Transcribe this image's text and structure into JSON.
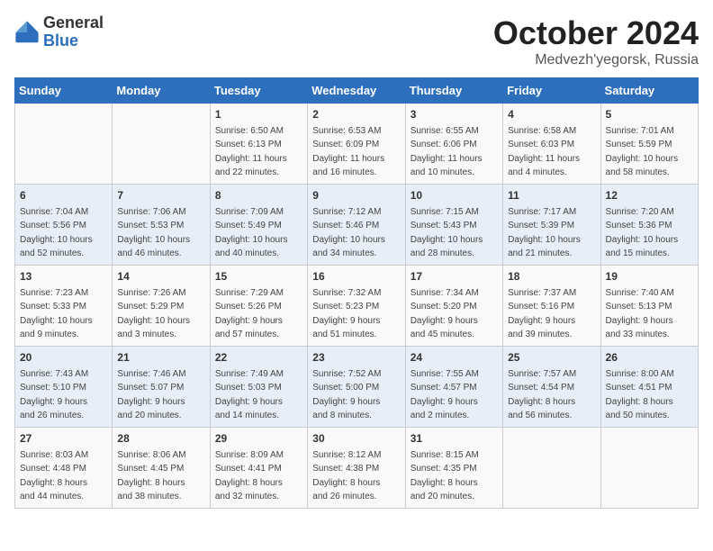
{
  "logo": {
    "general": "General",
    "blue": "Blue"
  },
  "title": {
    "month": "October 2024",
    "location": "Medvezh'yegorsk, Russia"
  },
  "days_of_week": [
    "Sunday",
    "Monday",
    "Tuesday",
    "Wednesday",
    "Thursday",
    "Friday",
    "Saturday"
  ],
  "weeks": [
    [
      {
        "day": "",
        "info": ""
      },
      {
        "day": "",
        "info": ""
      },
      {
        "day": "1",
        "info": "Sunrise: 6:50 AM\nSunset: 6:13 PM\nDaylight: 11 hours\nand 22 minutes."
      },
      {
        "day": "2",
        "info": "Sunrise: 6:53 AM\nSunset: 6:09 PM\nDaylight: 11 hours\nand 16 minutes."
      },
      {
        "day": "3",
        "info": "Sunrise: 6:55 AM\nSunset: 6:06 PM\nDaylight: 11 hours\nand 10 minutes."
      },
      {
        "day": "4",
        "info": "Sunrise: 6:58 AM\nSunset: 6:03 PM\nDaylight: 11 hours\nand 4 minutes."
      },
      {
        "day": "5",
        "info": "Sunrise: 7:01 AM\nSunset: 5:59 PM\nDaylight: 10 hours\nand 58 minutes."
      }
    ],
    [
      {
        "day": "6",
        "info": "Sunrise: 7:04 AM\nSunset: 5:56 PM\nDaylight: 10 hours\nand 52 minutes."
      },
      {
        "day": "7",
        "info": "Sunrise: 7:06 AM\nSunset: 5:53 PM\nDaylight: 10 hours\nand 46 minutes."
      },
      {
        "day": "8",
        "info": "Sunrise: 7:09 AM\nSunset: 5:49 PM\nDaylight: 10 hours\nand 40 minutes."
      },
      {
        "day": "9",
        "info": "Sunrise: 7:12 AM\nSunset: 5:46 PM\nDaylight: 10 hours\nand 34 minutes."
      },
      {
        "day": "10",
        "info": "Sunrise: 7:15 AM\nSunset: 5:43 PM\nDaylight: 10 hours\nand 28 minutes."
      },
      {
        "day": "11",
        "info": "Sunrise: 7:17 AM\nSunset: 5:39 PM\nDaylight: 10 hours\nand 21 minutes."
      },
      {
        "day": "12",
        "info": "Sunrise: 7:20 AM\nSunset: 5:36 PM\nDaylight: 10 hours\nand 15 minutes."
      }
    ],
    [
      {
        "day": "13",
        "info": "Sunrise: 7:23 AM\nSunset: 5:33 PM\nDaylight: 10 hours\nand 9 minutes."
      },
      {
        "day": "14",
        "info": "Sunrise: 7:26 AM\nSunset: 5:29 PM\nDaylight: 10 hours\nand 3 minutes."
      },
      {
        "day": "15",
        "info": "Sunrise: 7:29 AM\nSunset: 5:26 PM\nDaylight: 9 hours\nand 57 minutes."
      },
      {
        "day": "16",
        "info": "Sunrise: 7:32 AM\nSunset: 5:23 PM\nDaylight: 9 hours\nand 51 minutes."
      },
      {
        "day": "17",
        "info": "Sunrise: 7:34 AM\nSunset: 5:20 PM\nDaylight: 9 hours\nand 45 minutes."
      },
      {
        "day": "18",
        "info": "Sunrise: 7:37 AM\nSunset: 5:16 PM\nDaylight: 9 hours\nand 39 minutes."
      },
      {
        "day": "19",
        "info": "Sunrise: 7:40 AM\nSunset: 5:13 PM\nDaylight: 9 hours\nand 33 minutes."
      }
    ],
    [
      {
        "day": "20",
        "info": "Sunrise: 7:43 AM\nSunset: 5:10 PM\nDaylight: 9 hours\nand 26 minutes."
      },
      {
        "day": "21",
        "info": "Sunrise: 7:46 AM\nSunset: 5:07 PM\nDaylight: 9 hours\nand 20 minutes."
      },
      {
        "day": "22",
        "info": "Sunrise: 7:49 AM\nSunset: 5:03 PM\nDaylight: 9 hours\nand 14 minutes."
      },
      {
        "day": "23",
        "info": "Sunrise: 7:52 AM\nSunset: 5:00 PM\nDaylight: 9 hours\nand 8 minutes."
      },
      {
        "day": "24",
        "info": "Sunrise: 7:55 AM\nSunset: 4:57 PM\nDaylight: 9 hours\nand 2 minutes."
      },
      {
        "day": "25",
        "info": "Sunrise: 7:57 AM\nSunset: 4:54 PM\nDaylight: 8 hours\nand 56 minutes."
      },
      {
        "day": "26",
        "info": "Sunrise: 8:00 AM\nSunset: 4:51 PM\nDaylight: 8 hours\nand 50 minutes."
      }
    ],
    [
      {
        "day": "27",
        "info": "Sunrise: 8:03 AM\nSunset: 4:48 PM\nDaylight: 8 hours\nand 44 minutes."
      },
      {
        "day": "28",
        "info": "Sunrise: 8:06 AM\nSunset: 4:45 PM\nDaylight: 8 hours\nand 38 minutes."
      },
      {
        "day": "29",
        "info": "Sunrise: 8:09 AM\nSunset: 4:41 PM\nDaylight: 8 hours\nand 32 minutes."
      },
      {
        "day": "30",
        "info": "Sunrise: 8:12 AM\nSunset: 4:38 PM\nDaylight: 8 hours\nand 26 minutes."
      },
      {
        "day": "31",
        "info": "Sunrise: 8:15 AM\nSunset: 4:35 PM\nDaylight: 8 hours\nand 20 minutes."
      },
      {
        "day": "",
        "info": ""
      },
      {
        "day": "",
        "info": ""
      }
    ]
  ]
}
